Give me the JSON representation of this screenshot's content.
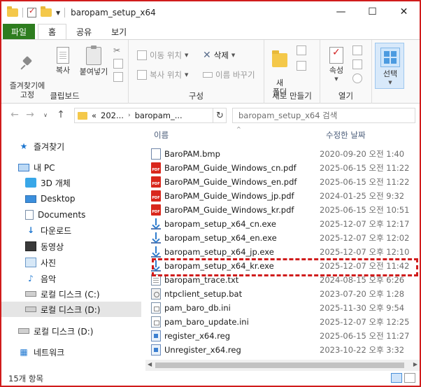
{
  "window": {
    "title": "baropam_setup_x64",
    "minimize": "—",
    "maximize": "☐",
    "close": "✕"
  },
  "tabs": [
    "파일",
    "홈",
    "공유",
    "보기"
  ],
  "ribbon": {
    "clipboard": {
      "pin_label": "즐겨찾기에\n고정",
      "copy_label": "복사",
      "paste_label": "붙여넣기",
      "group_label": "클립보드"
    },
    "organize": {
      "move_label": "이동 위치",
      "copy_to_label": "복사 위치",
      "delete_label": "삭제",
      "rename_label": "이름 바꾸기",
      "group_label": "구성"
    },
    "new": {
      "new_folder_label": "새\n폴더",
      "group_label": "새로 만들기"
    },
    "open": {
      "properties_label": "속성",
      "group_label": "열기"
    },
    "select": {
      "select_label": "선택"
    }
  },
  "address": {
    "prefix": "«",
    "segment1": "202...",
    "segment2": "baropam_...",
    "search_placeholder": "baropam_setup_x64 검색"
  },
  "nav_pane": {
    "items": [
      {
        "label": "즐겨찾기",
        "icon": "star-icon"
      },
      {
        "label": "내 PC",
        "icon": "pc-icon"
      },
      {
        "label": "3D 개체",
        "icon": "3d-objects-icon"
      },
      {
        "label": "Desktop",
        "icon": "desktop-icon"
      },
      {
        "label": "Documents",
        "icon": "documents-icon"
      },
      {
        "label": "다운로드",
        "icon": "download-icon"
      },
      {
        "label": "동영상",
        "icon": "video-icon"
      },
      {
        "label": "사진",
        "icon": "pictures-icon"
      },
      {
        "label": "음악",
        "icon": "music-icon"
      },
      {
        "label": "로컬 디스크 (C:)",
        "icon": "drive-icon"
      },
      {
        "label": "로컬 디스크 (D:)",
        "icon": "drive-icon"
      },
      {
        "label": "로컬 디스크 (D:)",
        "icon": "drive-icon"
      },
      {
        "label": "네트워크",
        "icon": "network-icon"
      }
    ]
  },
  "file_list": {
    "columns": {
      "name": "이름",
      "modified": "수정한 날짜"
    },
    "rows": [
      {
        "name": "BaroPAM.bmp",
        "modified": "2020-09-20 오전 1:40",
        "type": "bmp"
      },
      {
        "name": "BaroPAM_Guide_Windows_cn.pdf",
        "modified": "2025-06-15 오전 11:22",
        "type": "pdf"
      },
      {
        "name": "BaroPAM_Guide_Windows_en.pdf",
        "modified": "2025-06-15 오전 11:22",
        "type": "pdf"
      },
      {
        "name": "BaroPAM_Guide_Windows_jp.pdf",
        "modified": "2024-01-25 오전 9:32",
        "type": "pdf"
      },
      {
        "name": "BaroPAM_Guide_Windows_kr.pdf",
        "modified": "2025-06-15 오전 10:51",
        "type": "pdf"
      },
      {
        "name": "baropam_setup_x64_cn.exe",
        "modified": "2025-12-07 오후 12:17",
        "type": "exe"
      },
      {
        "name": "baropam_setup_x64_en.exe",
        "modified": "2025-12-07 오후 12:02",
        "type": "exe"
      },
      {
        "name": "baropam_setup_x64_jp.exe",
        "modified": "2025-12-07 오후 12:10",
        "type": "exe"
      },
      {
        "name": "baropam_setup_x64_kr.exe",
        "modified": "2025-12-07 오전 11:42",
        "type": "exe"
      },
      {
        "name": "baropam_trace.txt",
        "modified": "2024-08-15 오후 6:26",
        "type": "txt"
      },
      {
        "name": "ntpclient_setup.bat",
        "modified": "2023-07-20 오후 1:28",
        "type": "bat"
      },
      {
        "name": "pam_baro_db.ini",
        "modified": "2025-11-30 오후 9:54",
        "type": "ini"
      },
      {
        "name": "pam_baro_update.ini",
        "modified": "2025-12-07 오후 12:25",
        "type": "ini"
      },
      {
        "name": "register_x64.reg",
        "modified": "2025-06-15 오전 11:27",
        "type": "reg"
      },
      {
        "name": "Unregister_x64.reg",
        "modified": "2023-10-22 오후 3:32",
        "type": "reg"
      }
    ]
  },
  "status": {
    "count": "15개 항목"
  },
  "colors": {
    "accent_file_tab": "#2e7d1f",
    "highlight": "#d01c1c",
    "pdf_icon": "#d9271c"
  }
}
